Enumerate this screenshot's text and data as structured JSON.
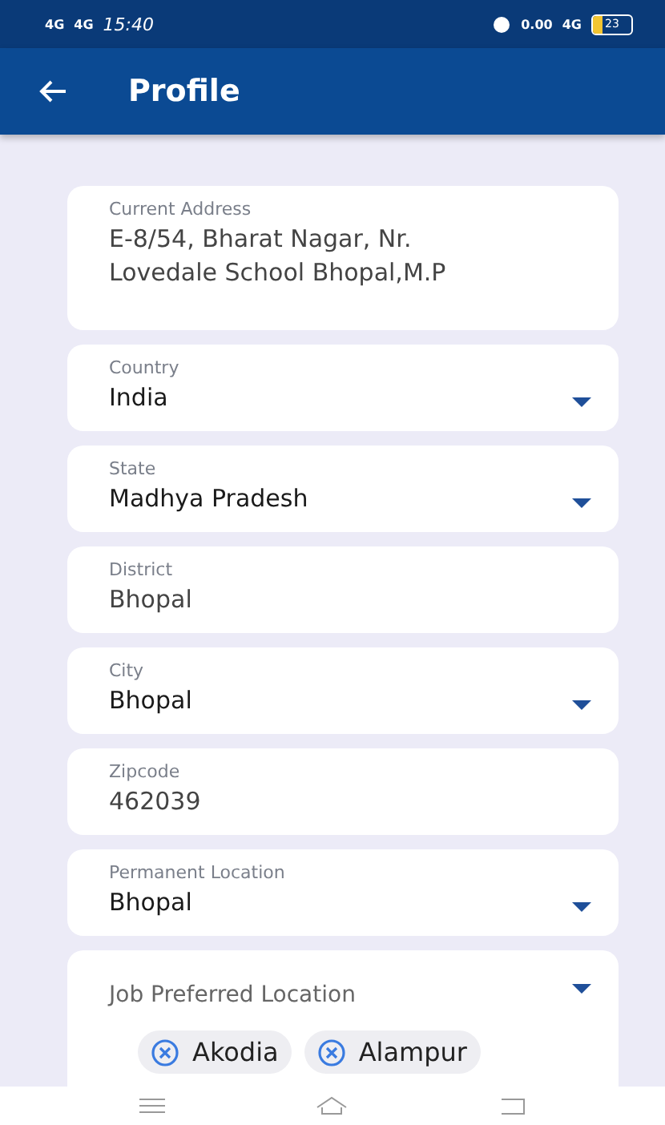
{
  "status_bar": {
    "left_signals": [
      "4G",
      "4G"
    ],
    "time": "15:40",
    "speed": "0.00",
    "network": "4G",
    "battery": "23"
  },
  "app_bar": {
    "title": "Profile"
  },
  "fields": [
    {
      "kind": "textarea",
      "label": "Current Address",
      "value": "E-8/54, Bharat Nagar, Nr. Lovedale School Bhopal,M.P"
    },
    {
      "kind": "dropdown",
      "label": "Country",
      "value": "India"
    },
    {
      "kind": "dropdown",
      "label": "State",
      "value": "Madhya Pradesh"
    },
    {
      "kind": "text",
      "label": "District",
      "value": "Bhopal"
    },
    {
      "kind": "dropdown",
      "label": "City",
      "value": "Bhopal"
    },
    {
      "kind": "text",
      "label": "Zipcode",
      "value": "462039"
    },
    {
      "kind": "dropdown",
      "label": "Permanent Location",
      "value": "Bhopal"
    }
  ],
  "multi_select": {
    "placeholder": "Job Preferred Location",
    "chips": [
      "Akodia",
      "Alampur"
    ]
  }
}
